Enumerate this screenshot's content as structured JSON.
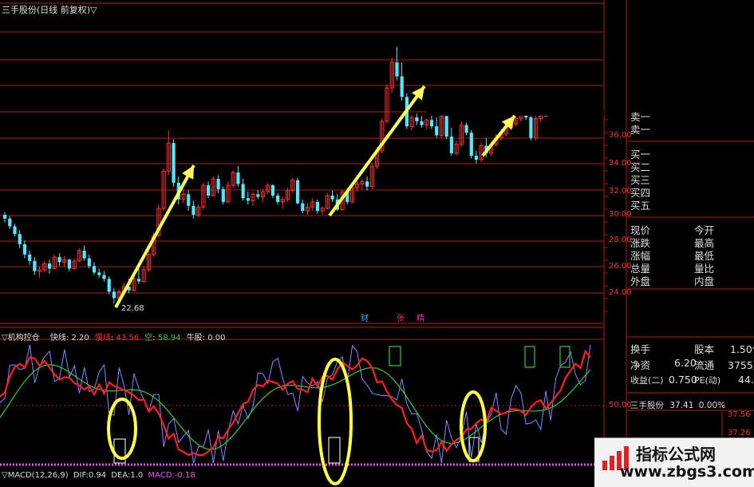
{
  "chart_title": "三手股份(日线 前复权)",
  "low_label": "22.68",
  "price_axis": [
    "36.00",
    "34.00",
    "32.00",
    "30.00",
    "28.00",
    "26.00",
    "24.00"
  ],
  "event_labels": [
    "财",
    "张",
    "精"
  ],
  "indicator": {
    "name": "机构控仓",
    "quick_label": "快线",
    "quick_value": "2.20",
    "slow_label": "慢线",
    "slow_value": "43.56",
    "empty_label": "空",
    "empty_value": "58.94",
    "bull_label": "牛股",
    "bull_value": "0.00",
    "axis_label": "50.00"
  },
  "macd": {
    "name": "MACD(12,26,9)",
    "dif_label": "DIF:",
    "dif_value": "0.94",
    "dea_label": "DEA:",
    "dea_value": "1.0",
    "macd_label": "MACD:",
    "macd_value": "-0.18"
  },
  "quote_panel": {
    "order_book": [
      "卖一",
      "卖一",
      "买一",
      "买二",
      "买三",
      "买四",
      "买五"
    ],
    "rows_left": [
      "现价",
      "涨跌",
      "涨幅",
      "总量",
      "外盘"
    ],
    "rows_right": [
      "今开",
      "最高",
      "最低",
      "量比",
      "内盘"
    ],
    "rows2": [
      {
        "label": "换手",
        "value": "",
        "label2": "股本",
        "value2": "1.50亿"
      },
      {
        "label": "净资",
        "value": "6.20",
        "label2": "流通",
        "value2": "3755万"
      },
      {
        "label": "收益(二)",
        "value": "0.750",
        "label2": "PE(动)",
        "value2": "44.4"
      }
    ],
    "mini_name": "三手股份",
    "mini_price": "37.41",
    "mini_change": "0.00%",
    "mini_axis": [
      "37.56",
      "37.26"
    ]
  },
  "watermark": {
    "main": "指标公式网",
    "sub": "www.zbgs3.com"
  },
  "colors": {
    "up": "#ff3030",
    "down": "#54e8ff",
    "arrow": "#ffff55",
    "grid": "#b01818",
    "circle": "#ffff44"
  },
  "chart_data": {
    "type": "candlestick",
    "candles": [
      [
        29.6,
        29.8,
        29.0,
        29.3
      ],
      [
        29.3,
        29.5,
        28.5,
        28.7
      ],
      [
        28.7,
        28.9,
        27.9,
        28.1
      ],
      [
        28.1,
        28.4,
        27.0,
        27.3
      ],
      [
        27.3,
        27.6,
        26.2,
        26.5
      ],
      [
        26.5,
        26.8,
        25.7,
        26.0
      ],
      [
        26.0,
        26.3,
        24.9,
        25.2
      ],
      [
        25.2,
        25.6,
        24.7,
        25.3
      ],
      [
        25.3,
        26.0,
        25.1,
        25.8
      ],
      [
        25.8,
        26.1,
        25.0,
        25.4
      ],
      [
        25.4,
        26.5,
        25.3,
        26.3
      ],
      [
        26.3,
        26.6,
        25.6,
        25.9
      ],
      [
        25.9,
        26.4,
        25.5,
        26.1
      ],
      [
        26.1,
        26.2,
        25.2,
        25.4
      ],
      [
        25.4,
        26.2,
        25.3,
        26.0
      ],
      [
        26.0,
        27.0,
        25.9,
        26.8
      ],
      [
        26.8,
        27.2,
        26.0,
        26.2
      ],
      [
        26.2,
        26.5,
        25.4,
        25.6
      ],
      [
        25.6,
        25.9,
        24.9,
        25.1
      ],
      [
        25.1,
        25.4,
        24.7,
        24.9
      ],
      [
        24.9,
        25.2,
        24.4,
        24.6
      ],
      [
        24.6,
        24.8,
        23.4,
        23.6
      ],
      [
        23.6,
        23.9,
        22.7,
        23.1
      ],
      [
        23.1,
        23.8,
        22.9,
        23.6
      ],
      [
        23.6,
        24.3,
        23.4,
        24.0
      ],
      [
        24.0,
        24.6,
        23.5,
        23.7
      ],
      [
        23.7,
        24.8,
        23.6,
        24.6
      ],
      [
        24.6,
        25.4,
        24.2,
        24.4
      ],
      [
        24.4,
        25.6,
        24.3,
        25.3
      ],
      [
        25.3,
        26.8,
        25.1,
        26.5
      ],
      [
        26.5,
        28.2,
        26.3,
        28.0
      ],
      [
        28.0,
        30.4,
        27.8,
        30.1
      ],
      [
        30.1,
        33.2,
        29.9,
        33.0
      ],
      [
        33.0,
        36.2,
        32.7,
        35.2
      ],
      [
        35.2,
        35.5,
        31.8,
        32.1
      ],
      [
        32.1,
        32.6,
        30.4,
        30.8
      ],
      [
        30.8,
        31.6,
        30.5,
        31.2
      ],
      [
        31.2,
        31.5,
        29.9,
        30.3
      ],
      [
        30.3,
        30.7,
        29.3,
        29.6
      ],
      [
        29.6,
        30.4,
        29.4,
        30.2
      ],
      [
        30.2,
        32.1,
        30.0,
        31.9
      ],
      [
        31.9,
        32.2,
        30.9,
        31.1
      ],
      [
        31.1,
        32.6,
        31.0,
        32.4
      ],
      [
        32.4,
        32.7,
        31.3,
        31.6
      ],
      [
        31.6,
        31.8,
        30.4,
        30.6
      ],
      [
        30.6,
        32.2,
        30.5,
        31.9
      ],
      [
        31.9,
        33.1,
        31.7,
        32.9
      ],
      [
        32.9,
        33.4,
        31.8,
        32.0
      ],
      [
        32.0,
        32.4,
        30.7,
        30.9
      ],
      [
        30.9,
        31.4,
        30.4,
        30.7
      ],
      [
        30.7,
        31.4,
        30.3,
        31.2
      ],
      [
        31.2,
        31.5,
        30.8,
        31.0
      ],
      [
        31.0,
        31.6,
        30.6,
        31.4
      ],
      [
        31.4,
        32.1,
        31.2,
        31.9
      ],
      [
        31.9,
        32.0,
        30.9,
        31.1
      ],
      [
        31.1,
        31.3,
        30.4,
        30.6
      ],
      [
        30.6,
        31.0,
        30.1,
        30.8
      ],
      [
        30.8,
        31.7,
        30.6,
        31.5
      ],
      [
        31.5,
        32.5,
        31.3,
        32.3
      ],
      [
        32.3,
        32.5,
        30.4,
        30.5
      ],
      [
        30.5,
        30.8,
        29.7,
        29.9
      ],
      [
        29.9,
        30.5,
        29.6,
        30.2
      ],
      [
        30.2,
        30.9,
        29.9,
        30.6
      ],
      [
        30.6,
        30.8,
        29.7,
        29.9
      ],
      [
        29.9,
        30.3,
        29.6,
        30.1
      ],
      [
        30.1,
        31.3,
        30.0,
        31.1
      ],
      [
        31.1,
        31.5,
        30.6,
        30.8
      ],
      [
        30.8,
        31.2,
        29.9,
        30.0
      ],
      [
        30.0,
        31.5,
        29.9,
        31.4
      ],
      [
        31.4,
        31.7,
        30.4,
        30.6
      ],
      [
        30.6,
        31.9,
        30.5,
        31.7
      ],
      [
        31.7,
        32.3,
        31.4,
        32.0
      ],
      [
        32.0,
        32.4,
        31.6,
        32.2
      ],
      [
        32.2,
        32.6,
        31.5,
        31.8
      ],
      [
        31.8,
        33.6,
        31.6,
        33.4
      ],
      [
        33.4,
        34.9,
        33.2,
        34.6
      ],
      [
        34.6,
        37.1,
        34.4,
        36.9
      ],
      [
        36.9,
        39.8,
        36.7,
        39.5
      ],
      [
        39.5,
        41.9,
        39.1,
        41.5
      ],
      [
        41.5,
        42.7,
        40.1,
        40.4
      ],
      [
        40.4,
        41.5,
        38.5,
        38.8
      ],
      [
        38.8,
        39.1,
        36.3,
        36.5
      ],
      [
        36.5,
        37.4,
        36.2,
        37.2
      ],
      [
        37.2,
        37.5,
        36.6,
        36.9
      ],
      [
        36.9,
        37.3,
        36.4,
        36.6
      ],
      [
        36.6,
        37.1,
        36.3,
        37.0
      ],
      [
        37.0,
        37.4,
        36.3,
        36.5
      ],
      [
        36.5,
        37.2,
        35.6,
        35.8
      ],
      [
        35.8,
        37.6,
        35.6,
        37.3
      ],
      [
        37.3,
        37.5,
        35.5,
        35.7
      ],
      [
        35.7,
        36.4,
        34.2,
        34.4
      ],
      [
        34.4,
        35.4,
        34.2,
        35.1
      ],
      [
        35.1,
        36.9,
        34.9,
        36.6
      ],
      [
        36.6,
        36.8,
        35.8,
        36.0
      ],
      [
        36.0,
        36.2,
        34.0,
        34.2
      ],
      [
        34.2,
        34.6,
        33.6,
        33.9
      ],
      [
        33.9,
        35.2,
        33.7,
        35.0
      ],
      [
        35.0,
        35.6,
        34.1,
        34.4
      ],
      [
        34.4,
        35.3,
        34.2,
        35.1
      ],
      [
        35.1,
        35.9,
        34.9,
        35.6
      ],
      [
        35.6,
        36.3,
        35.4,
        35.9
      ],
      [
        35.9,
        36.6,
        35.7,
        36.4
      ],
      [
        36.4,
        37.0,
        36.2,
        36.7
      ],
      [
        36.7,
        37.3,
        36.5,
        37.1
      ],
      [
        37.1,
        37.6,
        36.9,
        37.4
      ],
      [
        37.4,
        37.7,
        37.0,
        37.2
      ],
      [
        37.2,
        37.6,
        35.4,
        35.6
      ],
      [
        35.6,
        37.3,
        35.4,
        37.1
      ],
      [
        37.1,
        37.5,
        36.8,
        37.3
      ],
      [
        37.3,
        37.6,
        37.2,
        37.41
      ]
    ]
  }
}
